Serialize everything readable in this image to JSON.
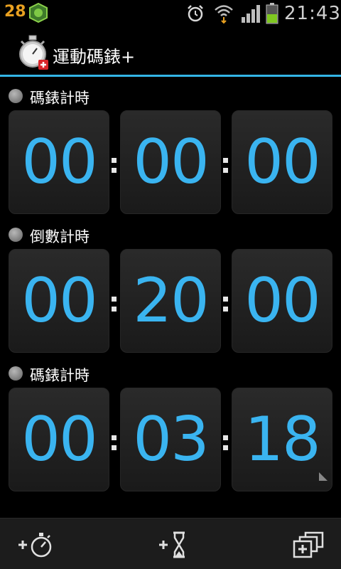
{
  "status_bar": {
    "notification_count": "28",
    "time": "21:43",
    "icons": [
      "app-notification-icon",
      "alarm-icon",
      "wifi-icon",
      "signal-icon",
      "battery-icon"
    ],
    "battery_color": "#7fc820"
  },
  "action_bar": {
    "title": "運動碼錶+",
    "app_icon": "stopwatch-icon",
    "accent_color": "#33b5e5"
  },
  "timers": [
    {
      "label": "碼錶計時",
      "hours": "00",
      "minutes": "00",
      "seconds": "00"
    },
    {
      "label": "倒數計時",
      "hours": "00",
      "minutes": "20",
      "seconds": "00"
    },
    {
      "label": "碼錶計時",
      "hours": "00",
      "minutes": "03",
      "seconds": "18"
    }
  ],
  "digit_color": "#3ab4f0",
  "bottom_bar": {
    "buttons": [
      "add-stopwatch-icon",
      "add-countdown-icon",
      "add-window-icon"
    ]
  }
}
